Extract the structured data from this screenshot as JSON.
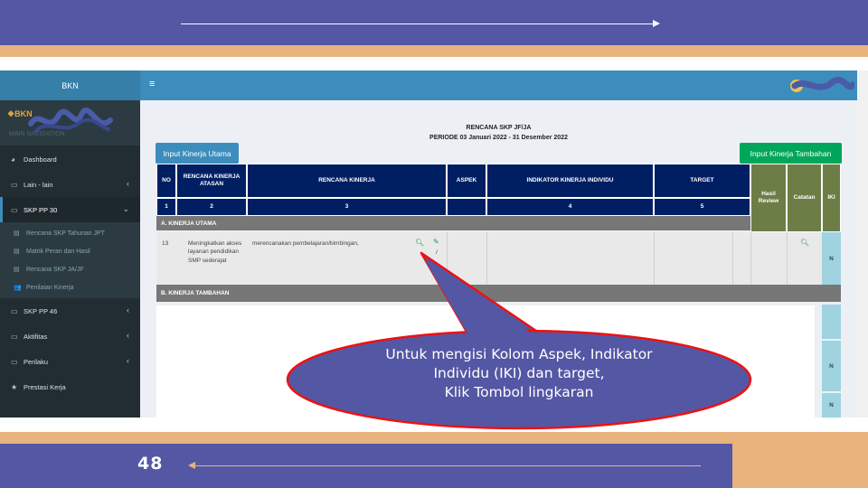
{
  "slide": {
    "page_number": "48",
    "colors": {
      "band": "#5457a4",
      "accent": "#e9b37d",
      "callout_fill": "#5457a4",
      "callout_stroke": "#ee1111"
    },
    "callout_text": [
      "Untuk  mengisi Kolom Aspek, Indikator",
      "Individu (IKI) dan target,",
      "Klik Tombol lingkaran"
    ]
  },
  "app": {
    "brand": "BKN",
    "user_logo": "BKN",
    "nav_header": "MAIN NAVIGATION",
    "menu": [
      {
        "label": "Dashboard",
        "icon": "dashboard-icon"
      },
      {
        "label": "Lain - lain",
        "icon": "folder-icon",
        "chevron": "‹"
      },
      {
        "label": "SKP PP 30",
        "icon": "folder-icon",
        "chevron": "⌄",
        "active": true
      },
      {
        "label": "SKP PP 46",
        "icon": "folder-icon",
        "chevron": "‹"
      },
      {
        "label": "Aktifitas",
        "icon": "folder-icon",
        "chevron": "‹"
      },
      {
        "label": "Perilaku",
        "icon": "folder-icon",
        "chevron": "‹"
      },
      {
        "label": "Prestasi Kerja",
        "icon": "star-icon"
      }
    ],
    "submenu": [
      {
        "label": "Rencana SKP Tahunan JPT",
        "icon": "book-icon"
      },
      {
        "label": "Matrik Peran dan Hasil",
        "icon": "book-icon"
      },
      {
        "label": "Rencana SKP JA/JF",
        "icon": "book-icon"
      },
      {
        "label": "Penilaian Kinerja",
        "icon": "users-icon"
      }
    ],
    "hamburger": "≡"
  },
  "content": {
    "title": "RENCANA SKP JF/JA",
    "period": "PERIODE 03 Januari 2022 - 31 Desember 2022",
    "btn_utama": "Input Kinerja Utama",
    "btn_tambahan": "Input Kinerja Tambahan",
    "headers": {
      "no": "NO",
      "atasan": "RENCANA KINERJA ATASAN",
      "rencana": "RENCANA KINERJA",
      "aspek": "ASPEK",
      "indikator": "INDIKATOR KINERJA INDIVIDU",
      "target": "TARGET",
      "hasil": "Hasil Review",
      "catatan": "Catatan",
      "iki": "IKI",
      "n1": "1",
      "n2": "2",
      "n3": "3",
      "n4": "4",
      "n5": "5"
    },
    "section_a": "A. KINERJA UTAMA",
    "section_b": "B. KINERJA TAMBAHAN",
    "row": {
      "no": "13",
      "atasan": "Meningkatkan akses layanan pendidikan SMP sederajat",
      "rencana": "merencanakan pembelajaran/bimbingan,",
      "iki": "N",
      "slash": "/"
    },
    "iki_extra": [
      "N",
      "N"
    ]
  }
}
